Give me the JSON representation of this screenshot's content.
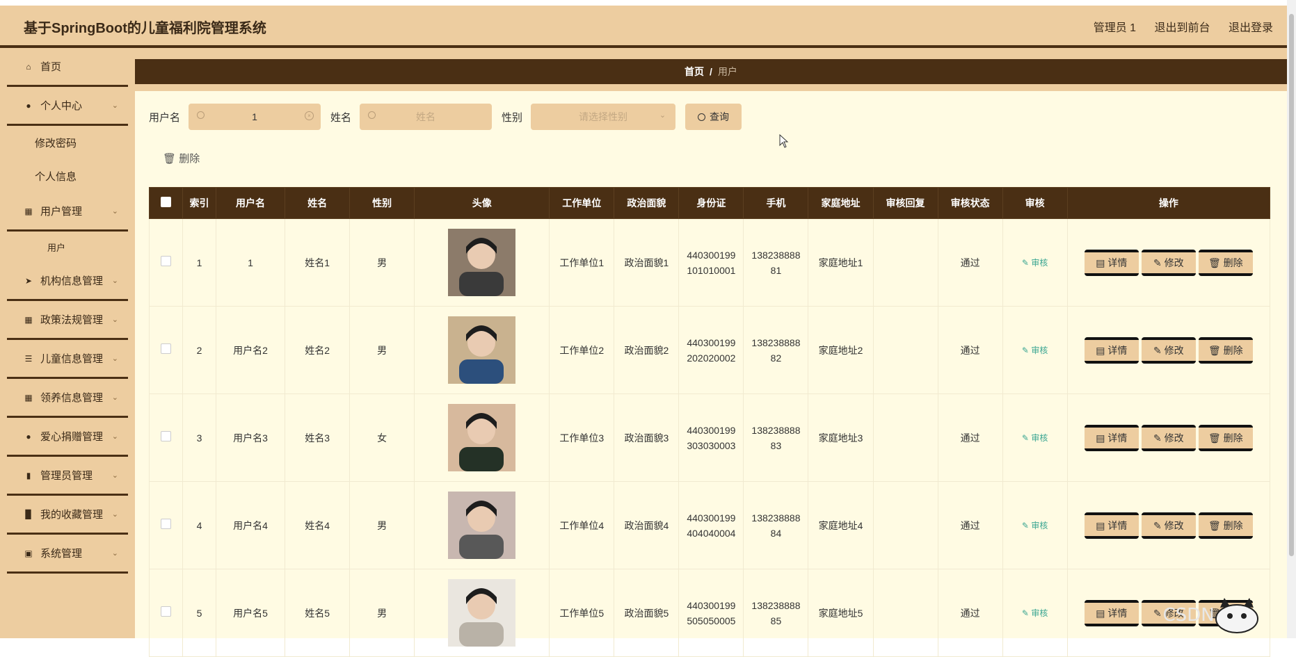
{
  "header": {
    "title": "基于SpringBoot的儿童福利院管理系统",
    "user": "管理员 1",
    "to_front": "退出到前台",
    "logout": "退出登录"
  },
  "sidebar": {
    "home": "首页",
    "personal": "个人中心",
    "change_pwd": "修改密码",
    "profile": "个人信息",
    "user_mgmt": "用户管理",
    "user": "用户",
    "org": "机构信息管理",
    "policy": "政策法规管理",
    "child": "儿童信息管理",
    "adopt": "领养信息管理",
    "donate": "爱心捐赠管理",
    "admin": "管理员管理",
    "fav": "我的收藏管理",
    "system": "系统管理"
  },
  "breadcrumb": {
    "home": "首页",
    "sep": "/",
    "current": "用户"
  },
  "search": {
    "username_label": "用户名",
    "username_value": "1",
    "name_label": "姓名",
    "name_placeholder": "姓名",
    "gender_label": "性别",
    "gender_placeholder": "请选择性别",
    "query_button": "查询"
  },
  "toolbar": {
    "delete": "删除"
  },
  "table": {
    "headers": [
      "索引",
      "用户名",
      "姓名",
      "性别",
      "头像",
      "工作单位",
      "政治面貌",
      "身份证",
      "手机",
      "家庭地址",
      "审核回复",
      "审核状态",
      "审核",
      "操作"
    ],
    "rows": [
      {
        "idx": "1",
        "username": "1",
        "name": "姓名1",
        "gender": "男",
        "work": "工作单位1",
        "political": "政治面貌1",
        "id1": "440300199",
        "id2": "101010001",
        "ph1": "138238888",
        "ph2": "81",
        "address": "家庭地址1",
        "reply": "",
        "status": "通过",
        "audit": "审核"
      },
      {
        "idx": "2",
        "username": "用户名2",
        "name": "姓名2",
        "gender": "男",
        "work": "工作单位2",
        "political": "政治面貌2",
        "id1": "440300199",
        "id2": "202020002",
        "ph1": "138238888",
        "ph2": "82",
        "address": "家庭地址2",
        "reply": "",
        "status": "通过",
        "audit": "审核"
      },
      {
        "idx": "3",
        "username": "用户名3",
        "name": "姓名3",
        "gender": "女",
        "work": "工作单位3",
        "political": "政治面貌3",
        "id1": "440300199",
        "id2": "303030003",
        "ph1": "138238888",
        "ph2": "83",
        "address": "家庭地址3",
        "reply": "",
        "status": "通过",
        "audit": "审核"
      },
      {
        "idx": "4",
        "username": "用户名4",
        "name": "姓名4",
        "gender": "男",
        "work": "工作单位4",
        "political": "政治面貌4",
        "id1": "440300199",
        "id2": "404040004",
        "ph1": "138238888",
        "ph2": "84",
        "address": "家庭地址4",
        "reply": "",
        "status": "通过",
        "audit": "审核"
      },
      {
        "idx": "5",
        "username": "用户名5",
        "name": "姓名5",
        "gender": "男",
        "work": "工作单位5",
        "political": "政治面貌5",
        "id1": "440300199",
        "id2": "505050005",
        "ph1": "138238888",
        "ph2": "85",
        "address": "家庭地址5",
        "reply": "",
        "status": "通过",
        "audit": "审核"
      }
    ],
    "ops": {
      "detail": "详情",
      "edit": "修改",
      "delete": "删除"
    }
  },
  "watermark": "CSDN @"
}
